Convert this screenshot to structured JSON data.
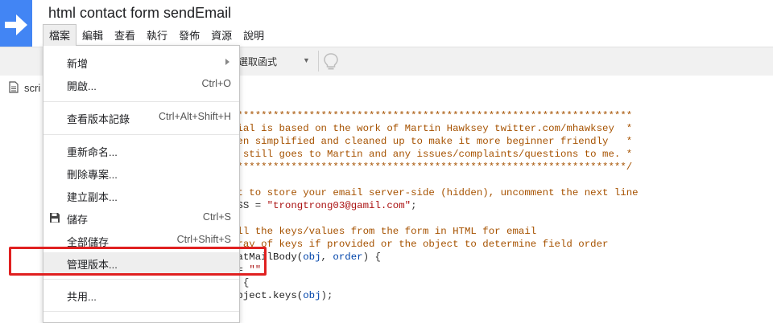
{
  "app": {
    "title": "html contact form sendEmail"
  },
  "menubar": {
    "items": [
      "檔案",
      "編輯",
      "查看",
      "執行",
      "發佈",
      "資源",
      "說明"
    ]
  },
  "toolbar": {
    "function_select": "選取函式"
  },
  "file_tab": {
    "label": "scri"
  },
  "file_menu": {
    "new": {
      "label": "新增"
    },
    "open": {
      "label": "開啟...",
      "shortcut": "Ctrl+O"
    },
    "version_history": {
      "label": "查看版本記錄",
      "shortcut": "Ctrl+Alt+Shift+H"
    },
    "rename": {
      "label": "重新命名..."
    },
    "delete": {
      "label": "刪除專案..."
    },
    "copy": {
      "label": "建立副本..."
    },
    "save": {
      "label": "儲存",
      "shortcut": "Ctrl+S"
    },
    "save_all": {
      "label": "全部儲存",
      "shortcut": "Ctrl+Shift+S"
    },
    "manage_versions": {
      "label": "管理版本..."
    },
    "share": {
      "label": "共用..."
    }
  },
  "code": {
    "line1": "*******************************************************************",
    "line2": "rial is based on the work of Martin Hawksey twitter.com/mhawksey  *",
    "line3": "een simplified and cleaned up to make it more beginner friendly   *",
    "line4": "t still goes to Martin and any issues/complaints/questions to me. *",
    "line5": "******************************************************************/",
    "line6": "nt to store your email server-side (hidden), uncomment the next line",
    "line7_a": "ESS = ",
    "line7_b": "\"trongtrong03@gamil.com\"",
    "line7_c": ";",
    "line8": "all the keys/values from the form in HTML for email",
    "line9": "rray of keys if provided or the object to determine field order",
    "line10_a": "matMailBody(",
    "line10_b": "obj",
    "line10_c": ", ",
    "line10_d": "order",
    "line10_e": ") {",
    "line11_a": " = ",
    "line11_b": "\"\"",
    "line12": ") {",
    "line13_a": "Object.keys(",
    "line13_b": "obj",
    "line13_c": ");"
  },
  "colors": {
    "accent": "#4285f4",
    "highlight": "#e02020"
  }
}
